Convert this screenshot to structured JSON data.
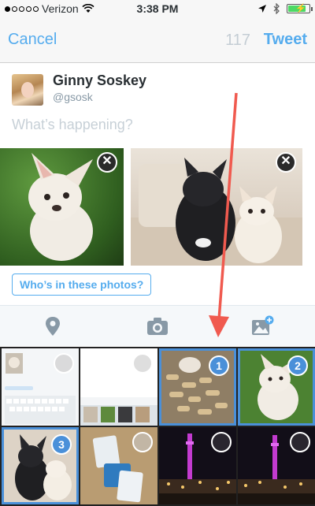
{
  "status_bar": {
    "carrier": "Verizon",
    "time": "3:38 PM",
    "signal_dots_filled": 1,
    "signal_dots_total": 5,
    "battery_level": 0.85,
    "icons": [
      "wifi-icon",
      "location-arrow-icon",
      "bluetooth-icon",
      "battery-icon"
    ]
  },
  "nav": {
    "cancel_label": "Cancel",
    "char_count": "117",
    "tweet_label": "Tweet"
  },
  "composer": {
    "user_name": "Ginny Soskey",
    "user_handle": "@gsosk",
    "placeholder": "What’s happening?"
  },
  "attachments": {
    "tag_label": "Who’s in these photos?",
    "remove_glyph": "✕"
  },
  "toolbar": {
    "icons": [
      "location-pin-icon",
      "camera-icon",
      "add-photo-icon"
    ]
  },
  "gallery": {
    "badges": [
      "1",
      "2",
      "3"
    ]
  },
  "colors": {
    "accent": "#55acee",
    "selection": "#4a90d9",
    "annotation_arrow": "#f05a4f"
  }
}
